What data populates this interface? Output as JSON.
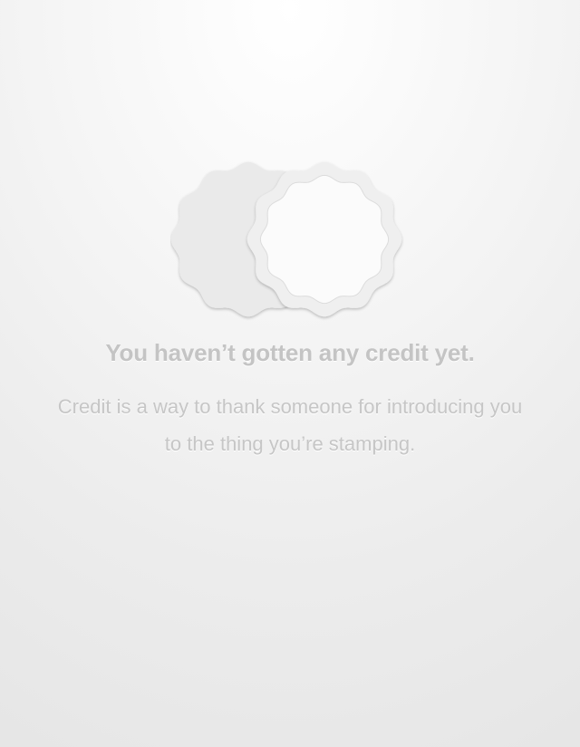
{
  "empty_state": {
    "illustration_icon": "overlapping-stamps-icon",
    "heading": "You haven’t gotten any credit yet.",
    "description": "Credit is a way to thank someone for introducing you to the thing you’re stamping."
  },
  "colors": {
    "background_top": "#ffffff",
    "background_bottom": "#e6e6e6",
    "stamp_fill": "#eaeaea",
    "text": "#c4c4c4"
  }
}
